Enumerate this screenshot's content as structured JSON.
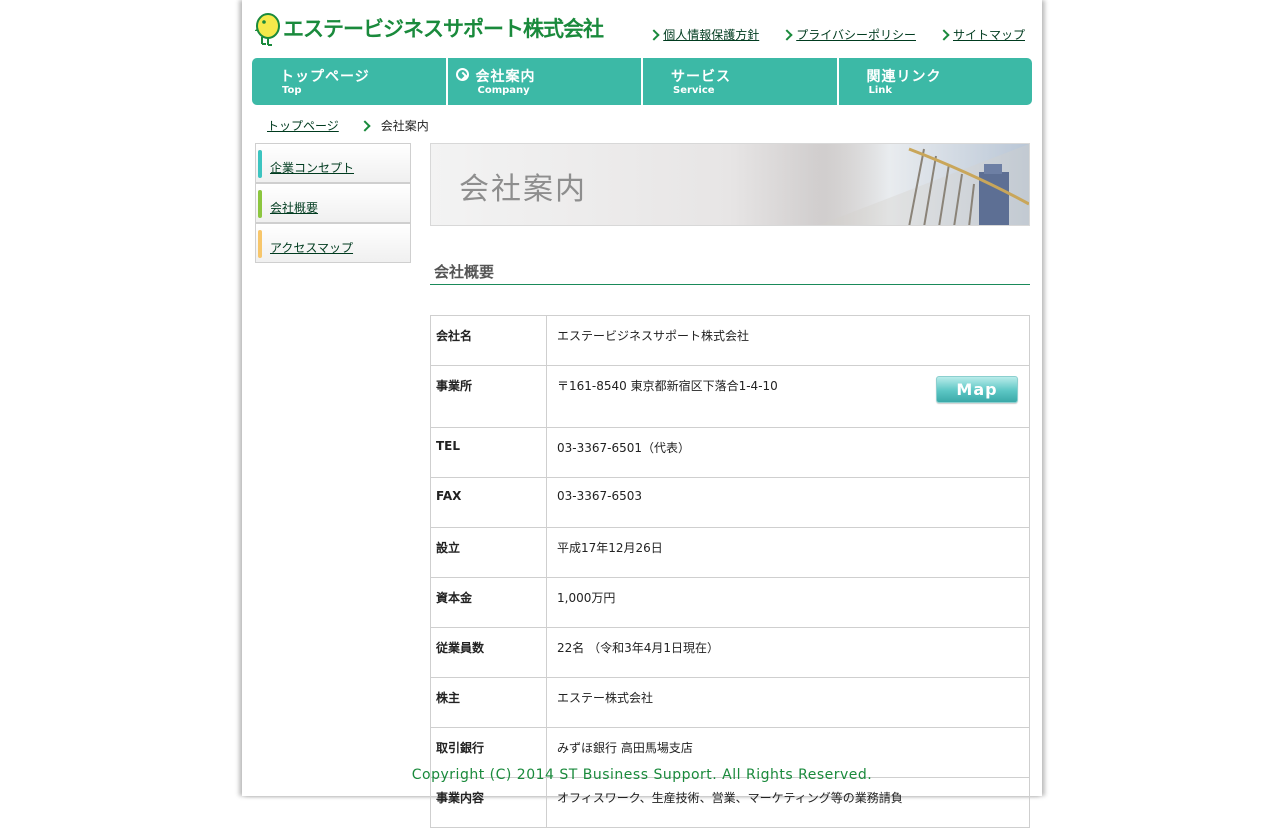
{
  "header": {
    "company_name": "エステービジネスサポート株式会社",
    "links": [
      "個人情報保護方針",
      "プライバシーポリシー",
      "サイトマップ"
    ]
  },
  "nav": [
    {
      "jp": "トップページ",
      "en": "Top",
      "active": false
    },
    {
      "jp": "会社案内",
      "en": "Company",
      "active": true
    },
    {
      "jp": "サービス",
      "en": "Service",
      "active": false
    },
    {
      "jp": "関連リンク",
      "en": "Link",
      "active": false
    }
  ],
  "breadcrumb": {
    "home": "トップページ",
    "current": "会社案内"
  },
  "sidebar": [
    {
      "label": "企業コンセプト",
      "color": "#3cc4c0"
    },
    {
      "label": "会社概要",
      "color": "#8cc63f"
    },
    {
      "label": "アクセスマップ",
      "color": "#f7c66b"
    }
  ],
  "banner": {
    "title": "会社案内"
  },
  "section": {
    "title": "会社概要"
  },
  "info": [
    {
      "key": "会社名",
      "value": "エステービジネスサポート株式会社"
    },
    {
      "key": "事業所",
      "value": "〒161-8540  東京都新宿区下落合1-4-10",
      "button": "Map"
    },
    {
      "key": "TEL",
      "value": "03-3367-6501（代表）"
    },
    {
      "key": "FAX",
      "value": "03-3367-6503"
    },
    {
      "key": "設立",
      "value": "平成17年12月26日"
    },
    {
      "key": "資本金",
      "value": "1,000万円"
    },
    {
      "key": "従業員数",
      "value": "22名 （令和3年4月1日現在）"
    },
    {
      "key": "株主",
      "value": "エステー株式会社"
    },
    {
      "key": "取引銀行",
      "value": "みずほ銀行 高田馬場支店"
    },
    {
      "key": "事業内容",
      "value": "オフィスワーク、生産技術、営業、マーケティング等の業務請負"
    }
  ],
  "footer": {
    "copyright": "Copyright (C)  2014 ST Business Support. All Rights Reserved."
  },
  "colors": {
    "brand_green": "#1a8a3c",
    "nav_teal": "#3cb9a6"
  }
}
